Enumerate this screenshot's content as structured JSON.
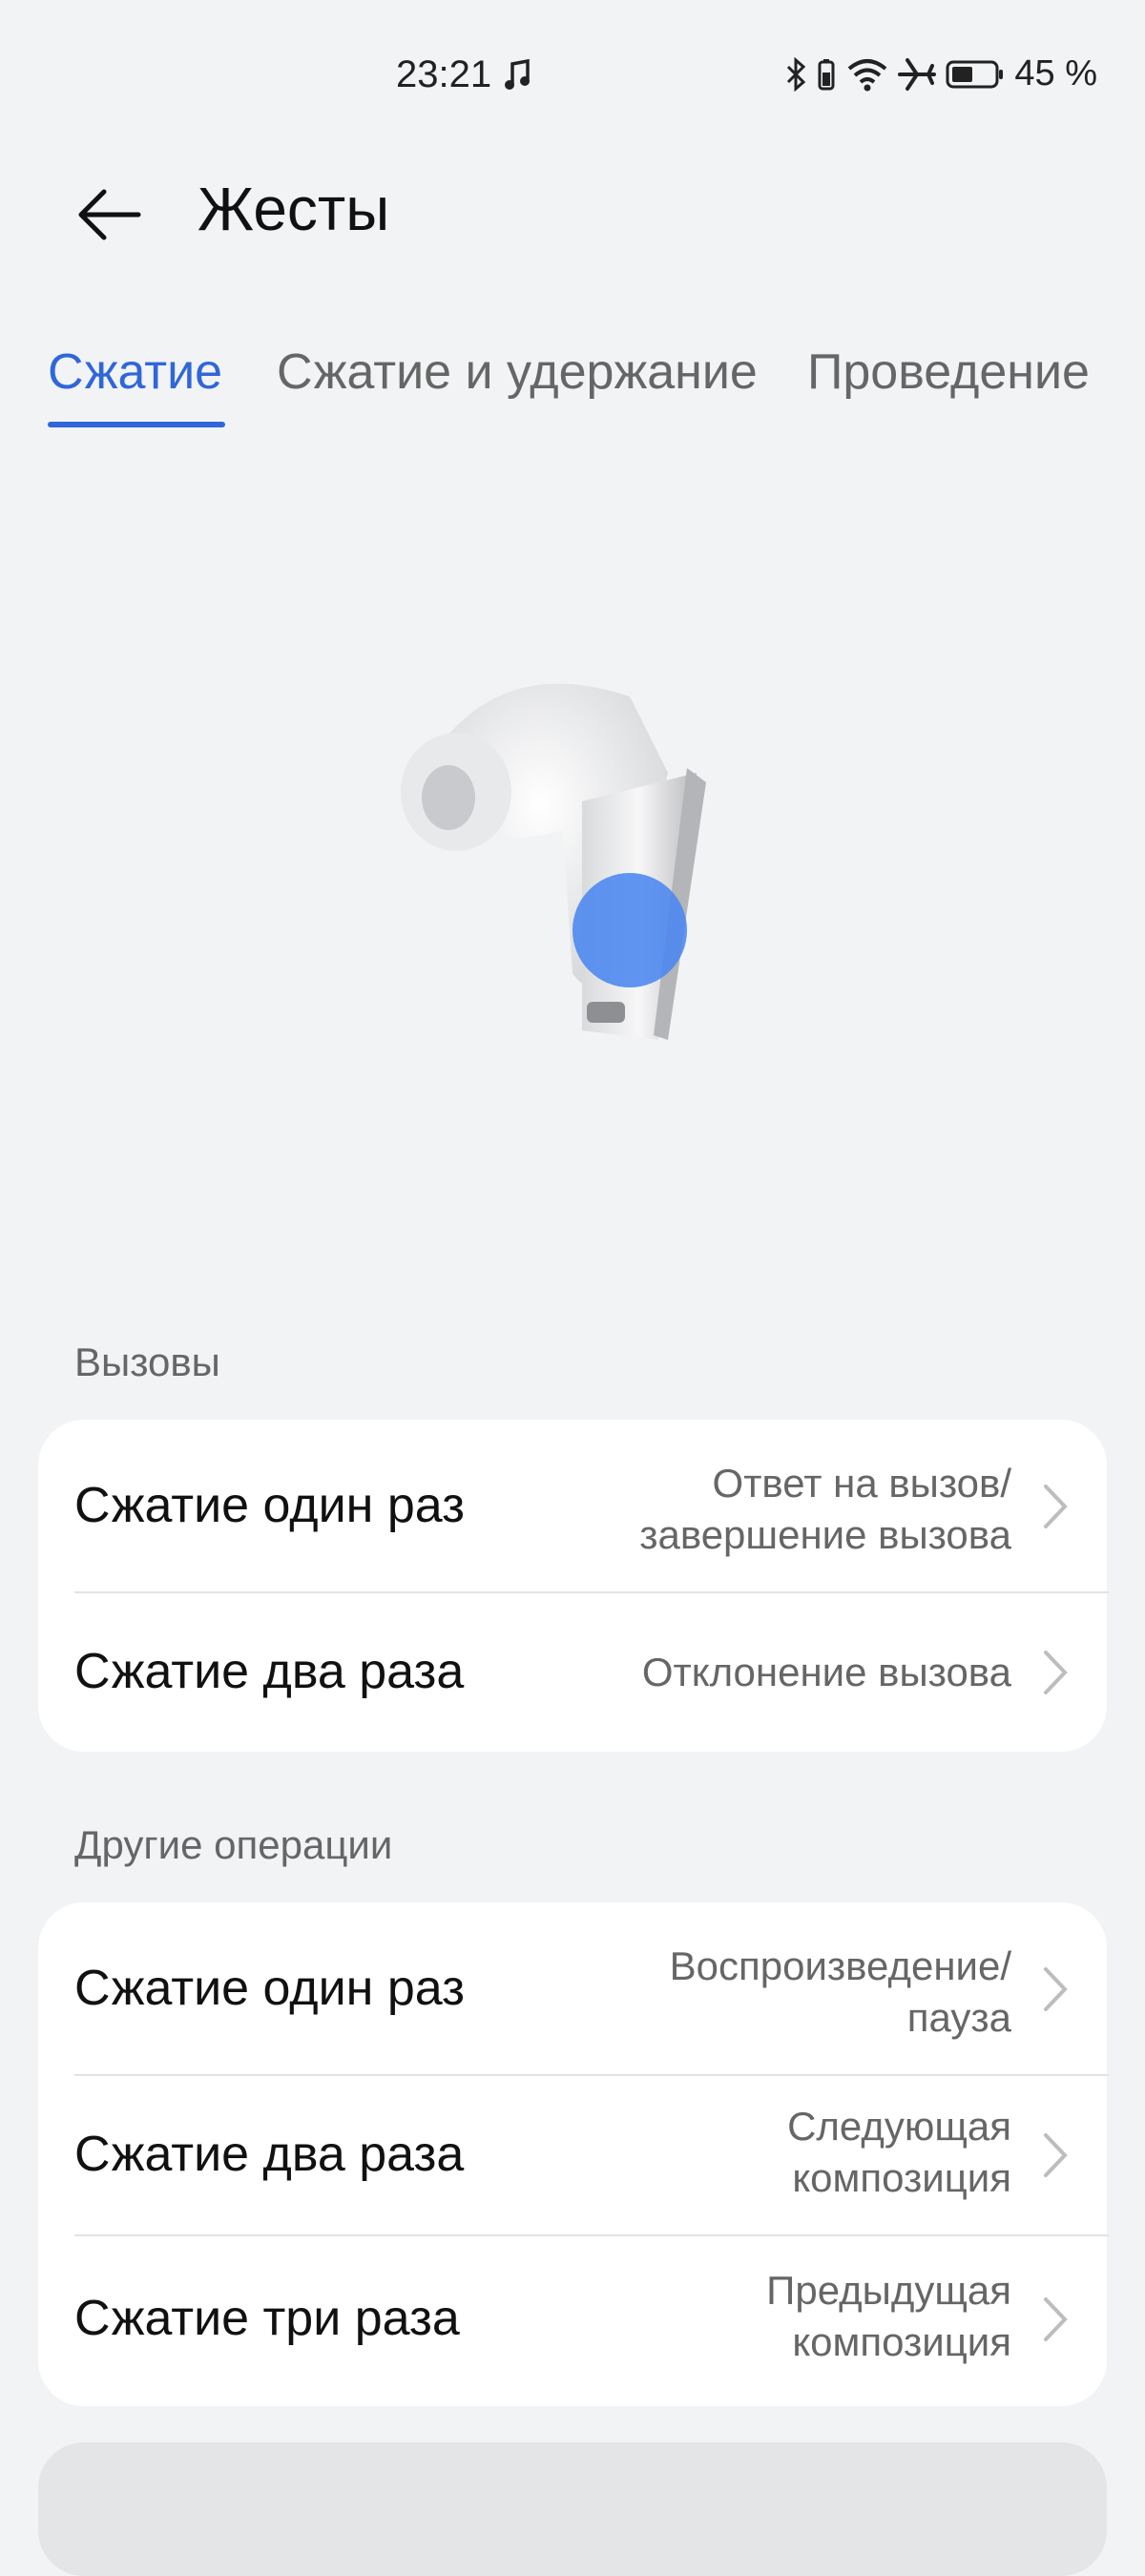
{
  "status_bar": {
    "time": "23:21",
    "battery": "45 %",
    "icons": [
      "music-note-icon",
      "bluetooth-icon",
      "vibrate-battery-icon",
      "wifi-icon",
      "airplane-icon",
      "battery-icon"
    ]
  },
  "header": {
    "title": "Жесты",
    "back_icon": "arrow-left-icon"
  },
  "tabs": [
    {
      "label": "Сжатие",
      "active": true
    },
    {
      "label": "Сжатие и удержание",
      "active": false
    },
    {
      "label": "Проведение",
      "active": false
    }
  ],
  "colors": {
    "accent": "#2f66d9",
    "background": "#f1f3f5",
    "card": "#ffffff",
    "touch_indicator": "#4a86f0"
  },
  "sections": [
    {
      "label": "Вызовы",
      "rows": [
        {
          "title": "Сжатие один раз",
          "value_line1": "Ответ на вызов/",
          "value_line2": "завершение вызова"
        },
        {
          "title": "Сжатие два раза",
          "value_line1": "Отклонение вызова",
          "value_line2": ""
        }
      ]
    },
    {
      "label": "Другие операции",
      "rows": [
        {
          "title": "Сжатие один раз",
          "value_line1": "Воспроизведение/",
          "value_line2": "пауза"
        },
        {
          "title": "Сжатие два раза",
          "value_line1": "Следующая",
          "value_line2": "композиция"
        },
        {
          "title": "Сжатие три раза",
          "value_line1": "Предыдущая",
          "value_line2": "композиция"
        }
      ]
    }
  ]
}
